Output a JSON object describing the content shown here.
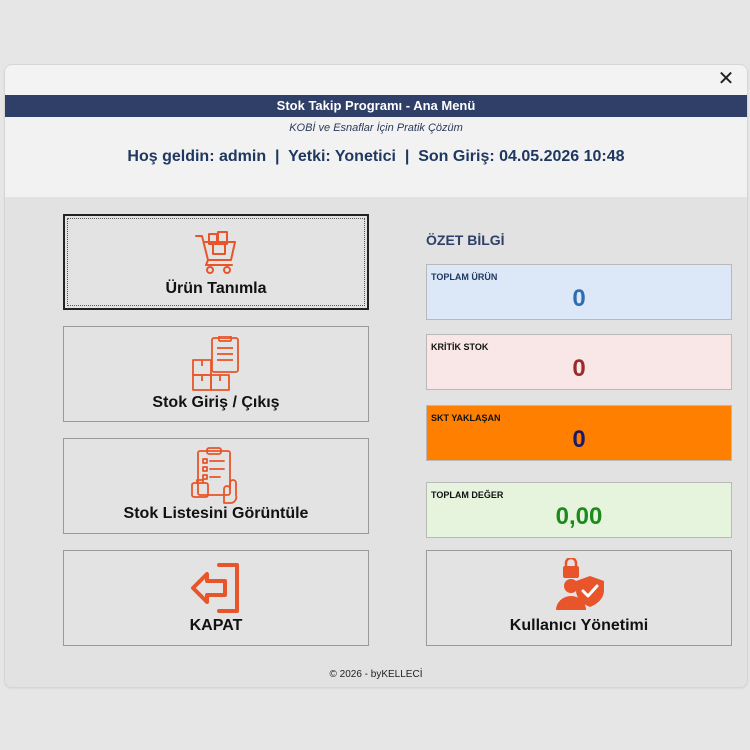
{
  "window": {
    "close_glyph": "✕"
  },
  "banner": {
    "title": "Stok Takip Programı - Ana Menü"
  },
  "header": {
    "subtitle": "KOBİ ve Esnaflar İçin Pratik Çözüm",
    "welcome": "Hoş geldin: admin  |  Yetki: Yonetici  |  Son Giriş: 04.05.2026 10:48"
  },
  "menu": {
    "urun_tanimla": {
      "label": "Ürün Tanımla",
      "icon": "shopping-cart-icon"
    },
    "stok_giris_cikis": {
      "label": "Stok Giriş / Çıkış",
      "icon": "warehouse-boxes-icon"
    },
    "stok_listesi": {
      "label": "Stok Listesini Görüntüle",
      "icon": "clipboard-list-icon"
    },
    "kapat": {
      "label": "KAPAT",
      "icon": "exit-arrow-icon"
    },
    "kullanici_yonetimi": {
      "label": "Kullanıcı Yönetimi",
      "icon": "user-security-icon"
    }
  },
  "summary": {
    "title": "ÖZET BİLGİ",
    "cards": [
      {
        "label": "TOPLAM ÜRÜN",
        "value": "0",
        "bg": "#dce8f7",
        "value_color": "#2e6db4",
        "label_color": "#1f3860"
      },
      {
        "label": "KRİTİK STOK",
        "value": "0",
        "bg": "#f9e6e6",
        "value_color": "#9b2a2a",
        "label_color": "#111111"
      },
      {
        "label": "SKT YAKLAŞAN",
        "value": "0",
        "bg": "#ff8000",
        "value_color": "#1a1a66",
        "label_color": "#111111"
      },
      {
        "label": "TOPLAM DEĞER",
        "value": "0,00",
        "bg": "#e6f3dd",
        "value_color": "#1c8a1c",
        "label_color": "#111111"
      }
    ]
  },
  "colors": {
    "accent_orange": "#e8552a",
    "banner": "#2f3f67"
  },
  "footer": {
    "text": "© 2026 - byKELLECİ"
  }
}
